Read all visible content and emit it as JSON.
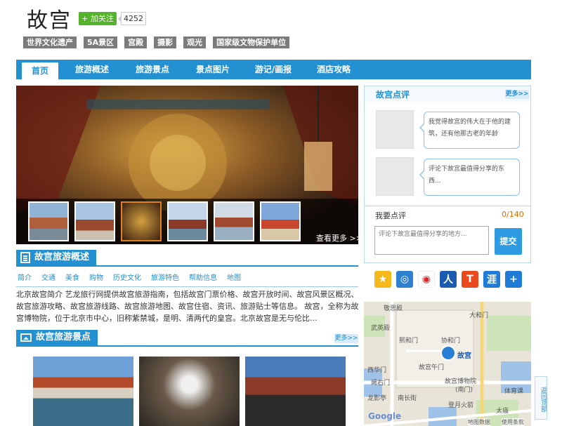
{
  "header": {
    "title": "故宫",
    "follow_label": "+ 加关注",
    "follow_count": "4252"
  },
  "tags": [
    "世界文化遗产",
    "5A景区",
    "宫殿",
    "摄影",
    "观光",
    "国家级文物保护单位"
  ],
  "nav": [
    "首页",
    "旅游概述",
    "旅游景点",
    "景点图片",
    "游记/画报",
    "酒店攻略"
  ],
  "slider": {
    "more_label": "查看更多 >>"
  },
  "overview": {
    "title": "故宫旅游概述",
    "subnav": [
      "简介",
      "交通",
      "美食",
      "购物",
      "历史文化",
      "旅游特色",
      "帮助信息",
      "地图"
    ],
    "text": "北京故宫简介 艺龙旅行网提供故宫旅游指南，包括故宫门票价格、故宫开放时间、故宫风景区概况、故宫旅游攻略、故宫旅游线路、故宫旅游地图、故宫住宿、资讯、旅游贴士等信息。 故宫，全称为故宫博物院，位于北京市中心，旧称紫禁城，是明、清两代的皇宫。北京故宫是无与伦比..."
  },
  "spots": {
    "title": "故宫旅游景点",
    "more_label": "更多>>"
  },
  "reviews": {
    "title": "故宫点评",
    "more_label": "更多>>",
    "comments": [
      "我觉得故宫的伟大在于他的建筑，还有他那古老的年龄",
      "评论下故宫最值得分享的东西..."
    ],
    "write_label": "我要点评",
    "counter": "0/140",
    "placeholder": "评论下故宫最值得分享的地方...",
    "submit_label": "提交"
  },
  "share_icons": [
    "star-icon",
    "qzone-icon",
    "weibo-icon",
    "renren-icon",
    "t-icon",
    "kaixin-icon",
    "plus-icon"
  ],
  "map": {
    "labels": [
      "敬思殿",
      "大和门",
      "武英殿",
      "熙和门",
      "协和门",
      "故宫",
      "故宫午门",
      "故宫博物院",
      "(南门)",
      "阙右门",
      "西华门",
      "登月火箭",
      "太庙",
      "体育课",
      "南长街",
      "龙影亭",
      "地图数据",
      "使用条款",
      "Google"
    ]
  },
  "backtop_label": "返回顶部",
  "colors": {
    "accent": "#2390d2",
    "follow": "#55b22c",
    "tag": "#7b7b7b"
  }
}
